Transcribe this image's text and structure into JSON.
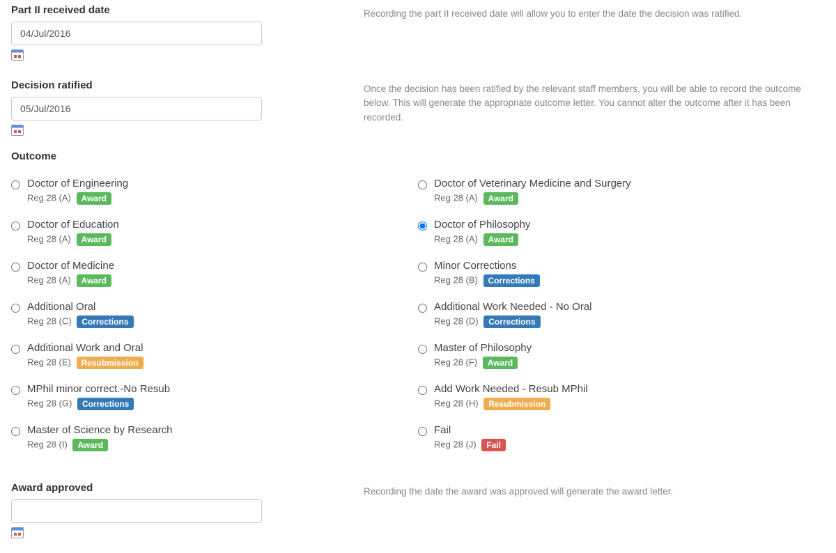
{
  "part2": {
    "label": "Part II received date",
    "value": "04/Jul/2016",
    "desc": "Recording the part II received date will allow you to enter the date the decision was ratified."
  },
  "ratified": {
    "label": "Decision ratified",
    "value": "05/Jul/2016",
    "desc": "Once the decision has been ratified by the relevant staff members, you will be able to record the outcome below. This will generate the appropriate outcome letter. You cannot alter the outcome after it has been recorded."
  },
  "outcome_label": "Outcome",
  "outcomes_left": [
    {
      "title": "Doctor of Engineering",
      "reg": "Reg 28 (A)",
      "badge": "Award",
      "badge_class": "b-award",
      "checked": false
    },
    {
      "title": "Doctor of Education",
      "reg": "Reg 28 (A)",
      "badge": "Award",
      "badge_class": "b-award",
      "checked": false
    },
    {
      "title": "Doctor of Medicine",
      "reg": "Reg 28 (A)",
      "badge": "Award",
      "badge_class": "b-award",
      "checked": false
    },
    {
      "title": "Additional Oral",
      "reg": "Reg 28 (C)",
      "badge": "Corrections",
      "badge_class": "b-corrections",
      "checked": false
    },
    {
      "title": "Additional Work and Oral",
      "reg": "Reg 28 (E)",
      "badge": "Resubmission",
      "badge_class": "b-resubmission",
      "checked": false
    },
    {
      "title": "MPhil minor correct.-No Resub",
      "reg": "Reg 28 (G)",
      "badge": "Corrections",
      "badge_class": "b-corrections",
      "checked": false
    },
    {
      "title": "Master of Science by Research",
      "reg": "Reg 28 (I)",
      "badge": "Award",
      "badge_class": "b-award",
      "checked": false
    }
  ],
  "outcomes_right": [
    {
      "title": "Doctor of Veterinary Medicine and Surgery",
      "reg": "Reg 28 (A)",
      "badge": "Award",
      "badge_class": "b-award",
      "checked": false
    },
    {
      "title": "Doctor of Philosophy",
      "reg": "Reg 28 (A)",
      "badge": "Award",
      "badge_class": "b-award",
      "checked": true
    },
    {
      "title": "Minor Corrections",
      "reg": "Reg 28 (B)",
      "badge": "Corrections",
      "badge_class": "b-corrections",
      "checked": false
    },
    {
      "title": "Additional Work Needed - No Oral",
      "reg": "Reg 28 (D)",
      "badge": "Corrections",
      "badge_class": "b-corrections",
      "checked": false
    },
    {
      "title": "Master of Philosophy",
      "reg": "Reg 28 (F)",
      "badge": "Award",
      "badge_class": "b-award",
      "checked": false
    },
    {
      "title": "Add Work Needed - Resub MPhil",
      "reg": "Reg 28 (H)",
      "badge": "Resubmission",
      "badge_class": "b-resubmission",
      "checked": false
    },
    {
      "title": "Fail",
      "reg": "Reg 28 (J)",
      "badge": "Fail",
      "badge_class": "b-fail",
      "checked": false
    }
  ],
  "approved": {
    "label": "Award approved",
    "value": "",
    "desc": "Recording the date the award was approved will generate the award letter."
  }
}
